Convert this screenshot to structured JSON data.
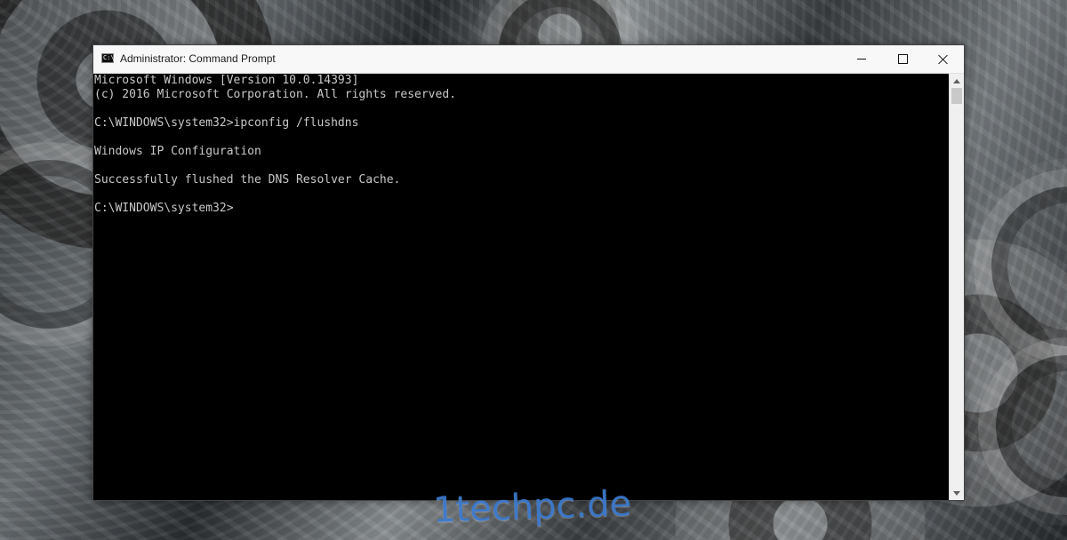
{
  "window": {
    "title": "Administrator: Command Prompt",
    "icon": "command-prompt-icon",
    "controls": [
      "minimize-icon",
      "maximize-icon",
      "close-icon"
    ]
  },
  "console": {
    "lines": [
      "Microsoft Windows [Version 10.0.14393]",
      "(c) 2016 Microsoft Corporation. All rights reserved.",
      "C:\\WINDOWS\\system32>ipconfig /flushdns",
      "Windows IP Configuration",
      "Successfully flushed the DNS Resolver Cache.",
      "C:\\WINDOWS\\system32>"
    ]
  },
  "watermark": {
    "text": "1techpc.de"
  },
  "colors": {
    "console_background": "#000000",
    "console_text": "#c8c8c8",
    "titlebar": "#f8f8f8",
    "watermark": "#3677ce"
  }
}
